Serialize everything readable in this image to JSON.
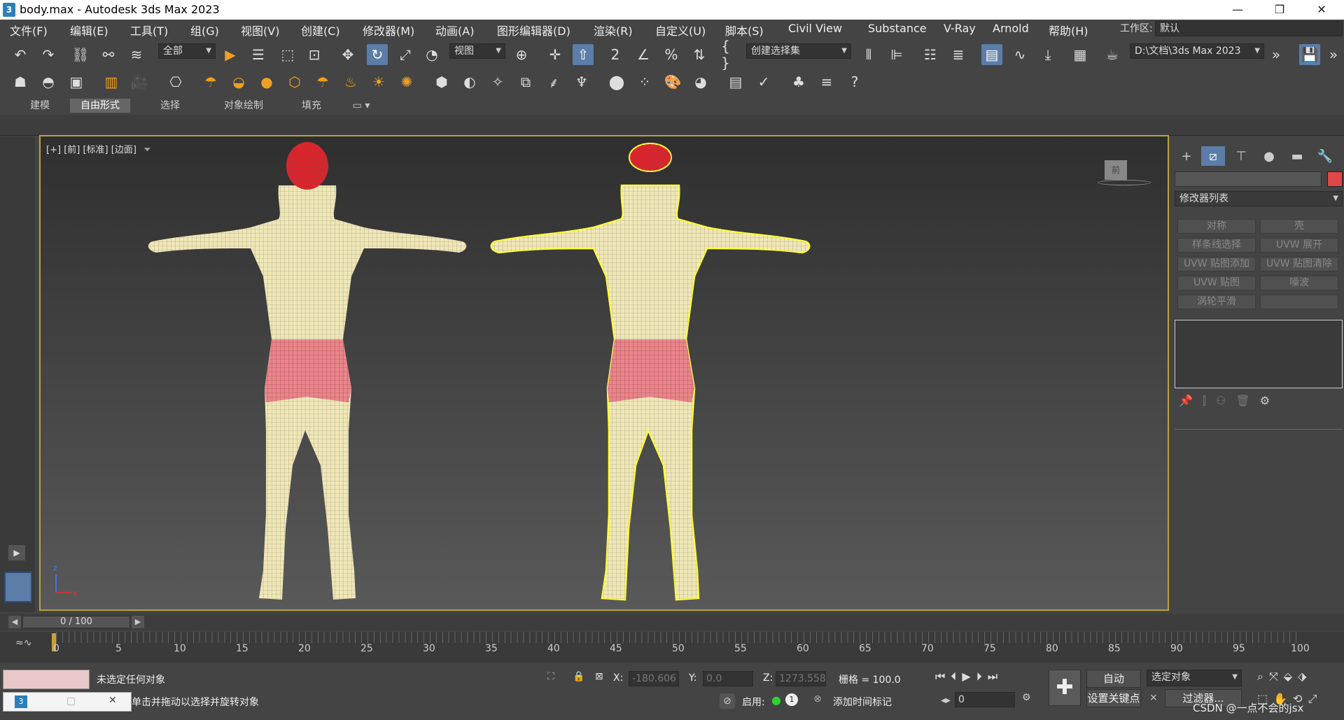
{
  "title": "body.max - Autodesk 3ds Max 2023",
  "menu": [
    "文件(F)",
    "编辑(E)",
    "工具(T)",
    "组(G)",
    "视图(V)",
    "创建(C)",
    "修改器(M)",
    "动画(A)",
    "图形编辑器(D)",
    "渲染(R)",
    "自定义(U)",
    "脚本(S)",
    "Civil View",
    "Substance",
    "V-Ray",
    "Arnold",
    "帮助(H)"
  ],
  "workspace": {
    "label": "工作区:",
    "value": "默认"
  },
  "toolbar": {
    "selection_filter": "全部",
    "ref_coord": "视图",
    "named_sel": "创建选择集",
    "project_path": "D:\\文档\\3ds Max 2023"
  },
  "ribbon_tabs": [
    "建模",
    "自由形式",
    "选择",
    "对象绘制",
    "填充"
  ],
  "viewport": {
    "label_plus": "[+]",
    "label_view": "[前]",
    "label_shading": "[标准]",
    "label_mode": "[边面]",
    "viewcube_text": "前"
  },
  "command_panel": {
    "modifier_list": "修改器列表",
    "color": "#e04848",
    "buttons": [
      "对称",
      "壳",
      "样条线选择",
      "UVW 展开",
      "UVW 贴图添加",
      "UVW 贴图清除",
      "UVW 贴图",
      "噪波",
      "涡轮平滑",
      ""
    ]
  },
  "time_slider": {
    "value": "0 / 100"
  },
  "timeline": {
    "ticks": [
      "0",
      "5",
      "10",
      "15",
      "20",
      "25",
      "30",
      "35",
      "40",
      "45",
      "50",
      "55",
      "60",
      "65",
      "70",
      "75",
      "80",
      "85",
      "90",
      "95",
      "100"
    ]
  },
  "status": {
    "selection_info": "未选定任何对象",
    "prompt": "单击并拖动以选择并旋转对象",
    "x_label": "X:",
    "x_value": "-180.606",
    "y_label": "Y:",
    "y_value": "0.0",
    "z_label": "Z:",
    "z_value": "1273.558",
    "grid": "栅格 = 100.0",
    "enable_label": "启用:",
    "add_time_tag": "添加时间标记",
    "auto_key": "自动",
    "set_key": "设置关键点",
    "selected_object": "选定对象",
    "filter": "过滤器...",
    "frame": "0",
    "watermark": "CSDN @一点不会的jsx"
  },
  "colors": {
    "selection_highlight": "#ffff40",
    "mesh_body": "#efe7b8",
    "mesh_shorts": "#e8868c",
    "mesh_cap": "#d8252c",
    "accent": "#5b7da8"
  }
}
